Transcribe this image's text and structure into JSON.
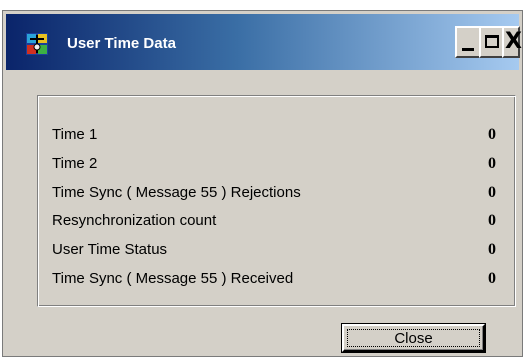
{
  "window": {
    "title": "User Time Data",
    "icon": "app-icon"
  },
  "titlebar_buttons": {
    "minimize_icon": "minimize-icon",
    "maximize_icon": "maximize-icon",
    "close_icon": "close-icon",
    "close_glyph": "X"
  },
  "rows": [
    {
      "label": "Time 1",
      "value": "0"
    },
    {
      "label": "Time 2",
      "value": "0"
    },
    {
      "label": "Time Sync ( Message 55 ) Rejections",
      "value": "0"
    },
    {
      "label": "Resynchronization count",
      "value": "0"
    },
    {
      "label": "User Time Status",
      "value": "0"
    },
    {
      "label": "Time Sync ( Message 55 ) Received",
      "value": "0"
    }
  ],
  "buttons": {
    "close_label": "Close"
  },
  "colors": {
    "titlebar_start": "#0a246a",
    "titlebar_end": "#a6caf0",
    "face": "#d4d0c8"
  }
}
